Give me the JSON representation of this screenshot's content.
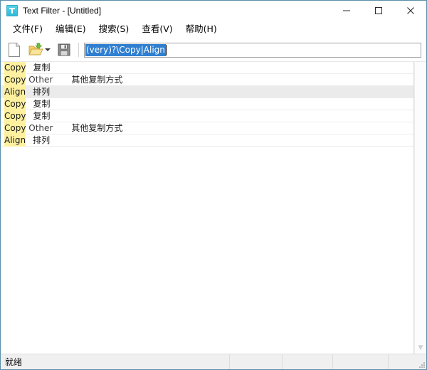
{
  "window": {
    "title": "Text Filter - [Untitled]",
    "icon": "filter-funnel-icon",
    "controls": {
      "minimize": "minimize-icon",
      "maximize": "maximize-icon",
      "close": "close-icon"
    }
  },
  "menubar": {
    "items": [
      {
        "label": "文件(F)"
      },
      {
        "label": "编辑(E)"
      },
      {
        "label": "搜索(S)"
      },
      {
        "label": "查看(V)"
      },
      {
        "label": "帮助(H)"
      }
    ]
  },
  "toolbar": {
    "new_icon": "new-document-icon",
    "open_icon": "open-folder-icon",
    "open_dropdown_icon": "chevron-down-icon",
    "save_icon": "save-floppy-icon",
    "search": {
      "value": "(very)?\\Copy|Align",
      "placeholder": "",
      "selected": true
    }
  },
  "list": {
    "rows": [
      {
        "match": "Copy",
        "rest": "",
        "tab": false,
        "translation": "复制",
        "selected": false
      },
      {
        "match": "Copy",
        "rest": " Other",
        "tab": true,
        "translation": "其他复制方式",
        "selected": false
      },
      {
        "match": "Align",
        "rest": "",
        "tab": false,
        "translation": "排列",
        "selected": true
      },
      {
        "match": "Copy",
        "rest": "",
        "tab": false,
        "translation": "复制",
        "selected": false
      },
      {
        "match": "Copy",
        "rest": "",
        "tab": false,
        "translation": "复制",
        "selected": false
      },
      {
        "match": "Copy",
        "rest": " Other",
        "tab": true,
        "translation": "其他复制方式",
        "selected": false
      },
      {
        "match": "Align",
        "rest": "",
        "tab": false,
        "translation": "排列",
        "selected": false
      }
    ],
    "scrollbar": {
      "down_arrow_icon": "chevron-down-icon"
    }
  },
  "statusbar": {
    "message": "就绪",
    "cell2": "",
    "cell3": "",
    "cell4": "",
    "cell5": "",
    "resize_grip_icon": "resize-grip-icon"
  },
  "colors": {
    "window_border": "#5a8fa8",
    "highlight_match": "#fdf1a0",
    "selection_blue": "#2f7fd1",
    "row_selected": "#ebebeb",
    "statusbar_bg": "#f0f0f0",
    "app_icon": "#2fb8d8"
  }
}
